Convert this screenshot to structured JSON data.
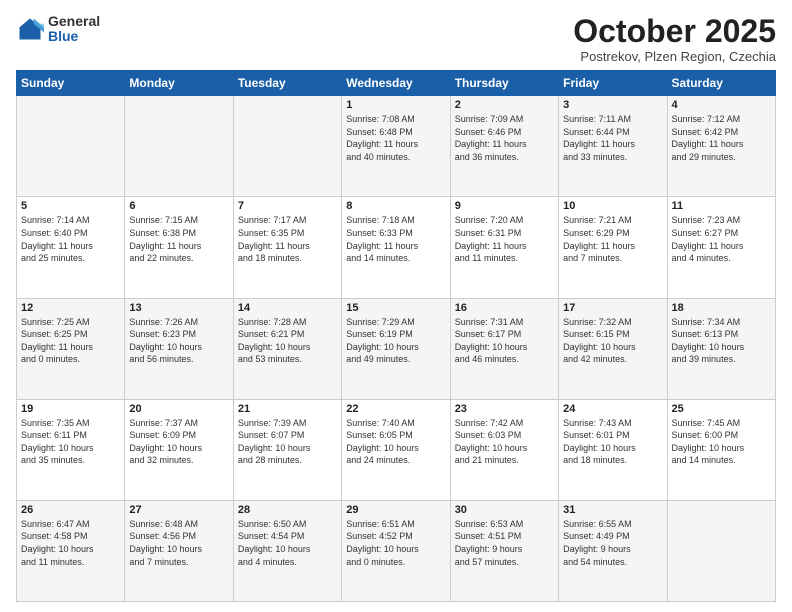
{
  "header": {
    "logo_general": "General",
    "logo_blue": "Blue",
    "month": "October 2025",
    "location": "Postrekov, Plzen Region, Czechia"
  },
  "days_of_week": [
    "Sunday",
    "Monday",
    "Tuesday",
    "Wednesday",
    "Thursday",
    "Friday",
    "Saturday"
  ],
  "weeks": [
    [
      {
        "num": "",
        "info": ""
      },
      {
        "num": "",
        "info": ""
      },
      {
        "num": "",
        "info": ""
      },
      {
        "num": "1",
        "info": "Sunrise: 7:08 AM\nSunset: 6:48 PM\nDaylight: 11 hours\nand 40 minutes."
      },
      {
        "num": "2",
        "info": "Sunrise: 7:09 AM\nSunset: 6:46 PM\nDaylight: 11 hours\nand 36 minutes."
      },
      {
        "num": "3",
        "info": "Sunrise: 7:11 AM\nSunset: 6:44 PM\nDaylight: 11 hours\nand 33 minutes."
      },
      {
        "num": "4",
        "info": "Sunrise: 7:12 AM\nSunset: 6:42 PM\nDaylight: 11 hours\nand 29 minutes."
      }
    ],
    [
      {
        "num": "5",
        "info": "Sunrise: 7:14 AM\nSunset: 6:40 PM\nDaylight: 11 hours\nand 25 minutes."
      },
      {
        "num": "6",
        "info": "Sunrise: 7:15 AM\nSunset: 6:38 PM\nDaylight: 11 hours\nand 22 minutes."
      },
      {
        "num": "7",
        "info": "Sunrise: 7:17 AM\nSunset: 6:35 PM\nDaylight: 11 hours\nand 18 minutes."
      },
      {
        "num": "8",
        "info": "Sunrise: 7:18 AM\nSunset: 6:33 PM\nDaylight: 11 hours\nand 14 minutes."
      },
      {
        "num": "9",
        "info": "Sunrise: 7:20 AM\nSunset: 6:31 PM\nDaylight: 11 hours\nand 11 minutes."
      },
      {
        "num": "10",
        "info": "Sunrise: 7:21 AM\nSunset: 6:29 PM\nDaylight: 11 hours\nand 7 minutes."
      },
      {
        "num": "11",
        "info": "Sunrise: 7:23 AM\nSunset: 6:27 PM\nDaylight: 11 hours\nand 4 minutes."
      }
    ],
    [
      {
        "num": "12",
        "info": "Sunrise: 7:25 AM\nSunset: 6:25 PM\nDaylight: 11 hours\nand 0 minutes."
      },
      {
        "num": "13",
        "info": "Sunrise: 7:26 AM\nSunset: 6:23 PM\nDaylight: 10 hours\nand 56 minutes."
      },
      {
        "num": "14",
        "info": "Sunrise: 7:28 AM\nSunset: 6:21 PM\nDaylight: 10 hours\nand 53 minutes."
      },
      {
        "num": "15",
        "info": "Sunrise: 7:29 AM\nSunset: 6:19 PM\nDaylight: 10 hours\nand 49 minutes."
      },
      {
        "num": "16",
        "info": "Sunrise: 7:31 AM\nSunset: 6:17 PM\nDaylight: 10 hours\nand 46 minutes."
      },
      {
        "num": "17",
        "info": "Sunrise: 7:32 AM\nSunset: 6:15 PM\nDaylight: 10 hours\nand 42 minutes."
      },
      {
        "num": "18",
        "info": "Sunrise: 7:34 AM\nSunset: 6:13 PM\nDaylight: 10 hours\nand 39 minutes."
      }
    ],
    [
      {
        "num": "19",
        "info": "Sunrise: 7:35 AM\nSunset: 6:11 PM\nDaylight: 10 hours\nand 35 minutes."
      },
      {
        "num": "20",
        "info": "Sunrise: 7:37 AM\nSunset: 6:09 PM\nDaylight: 10 hours\nand 32 minutes."
      },
      {
        "num": "21",
        "info": "Sunrise: 7:39 AM\nSunset: 6:07 PM\nDaylight: 10 hours\nand 28 minutes."
      },
      {
        "num": "22",
        "info": "Sunrise: 7:40 AM\nSunset: 6:05 PM\nDaylight: 10 hours\nand 24 minutes."
      },
      {
        "num": "23",
        "info": "Sunrise: 7:42 AM\nSunset: 6:03 PM\nDaylight: 10 hours\nand 21 minutes."
      },
      {
        "num": "24",
        "info": "Sunrise: 7:43 AM\nSunset: 6:01 PM\nDaylight: 10 hours\nand 18 minutes."
      },
      {
        "num": "25",
        "info": "Sunrise: 7:45 AM\nSunset: 6:00 PM\nDaylight: 10 hours\nand 14 minutes."
      }
    ],
    [
      {
        "num": "26",
        "info": "Sunrise: 6:47 AM\nSunset: 4:58 PM\nDaylight: 10 hours\nand 11 minutes."
      },
      {
        "num": "27",
        "info": "Sunrise: 6:48 AM\nSunset: 4:56 PM\nDaylight: 10 hours\nand 7 minutes."
      },
      {
        "num": "28",
        "info": "Sunrise: 6:50 AM\nSunset: 4:54 PM\nDaylight: 10 hours\nand 4 minutes."
      },
      {
        "num": "29",
        "info": "Sunrise: 6:51 AM\nSunset: 4:52 PM\nDaylight: 10 hours\nand 0 minutes."
      },
      {
        "num": "30",
        "info": "Sunrise: 6:53 AM\nSunset: 4:51 PM\nDaylight: 9 hours\nand 57 minutes."
      },
      {
        "num": "31",
        "info": "Sunrise: 6:55 AM\nSunset: 4:49 PM\nDaylight: 9 hours\nand 54 minutes."
      },
      {
        "num": "",
        "info": ""
      }
    ]
  ]
}
